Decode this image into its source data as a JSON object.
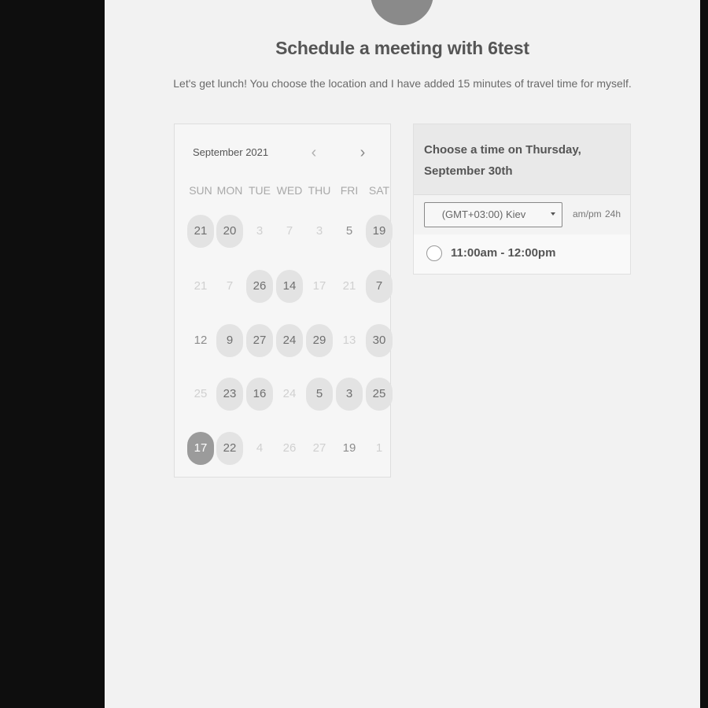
{
  "header": {
    "title": "Schedule a meeting with 6test",
    "description": "Let's get lunch! You choose the location and I have added 15 minutes of travel time for myself."
  },
  "calendar": {
    "month_label": "September 2021",
    "prev_icon": "chevron-left-icon",
    "next_icon": "chevron-right-icon",
    "prev_glyph": "‹",
    "next_glyph": "›",
    "weekdays": [
      "SUN",
      "MON",
      "TUE",
      "WED",
      "THU",
      "FRI",
      "SAT"
    ],
    "weeks": [
      [
        {
          "d": "21",
          "a": true
        },
        {
          "d": "20",
          "a": true
        },
        {
          "d": "3",
          "a": false
        },
        {
          "d": "7",
          "a": false
        },
        {
          "d": "3",
          "a": false
        },
        {
          "d": "5",
          "a": false,
          "m": true
        },
        {
          "d": "19",
          "a": true
        }
      ],
      [
        {
          "d": "21",
          "a": false
        },
        {
          "d": "7",
          "a": false
        },
        {
          "d": "26",
          "a": true
        },
        {
          "d": "14",
          "a": true
        },
        {
          "d": "17",
          "a": false
        },
        {
          "d": "21",
          "a": false
        },
        {
          "d": "7",
          "a": true
        }
      ],
      [
        {
          "d": "12",
          "a": false,
          "m": true
        },
        {
          "d": "9",
          "a": true
        },
        {
          "d": "27",
          "a": true
        },
        {
          "d": "24",
          "a": true
        },
        {
          "d": "29",
          "a": true
        },
        {
          "d": "13",
          "a": false
        },
        {
          "d": "30",
          "a": true
        }
      ],
      [
        {
          "d": "25",
          "a": false
        },
        {
          "d": "23",
          "a": true
        },
        {
          "d": "16",
          "a": true
        },
        {
          "d": "24",
          "a": false
        },
        {
          "d": "5",
          "a": true
        },
        {
          "d": "3",
          "a": true
        },
        {
          "d": "25",
          "a": true
        }
      ],
      [
        {
          "d": "17",
          "a": true,
          "s": true
        },
        {
          "d": "22",
          "a": true
        },
        {
          "d": "4",
          "a": false
        },
        {
          "d": "26",
          "a": false
        },
        {
          "d": "27",
          "a": false
        },
        {
          "d": "19",
          "a": false,
          "m": true
        },
        {
          "d": "1",
          "a": false
        }
      ]
    ]
  },
  "times": {
    "heading": "Choose a time on Thursday, September 30th",
    "timezone": "(GMT+03:00) Kiev",
    "dropdown_icon": "caret-down-icon",
    "format_ampm": "am/pm",
    "format_24": "24h",
    "slots": [
      {
        "label": "11:00am - 12:00pm",
        "selected": false
      }
    ]
  },
  "colors": {
    "page_background": "#f2f2f2",
    "frame_background": "#0e0e0e",
    "available_day": "#e3e3e3",
    "selected_day": "#9b9b9b"
  }
}
